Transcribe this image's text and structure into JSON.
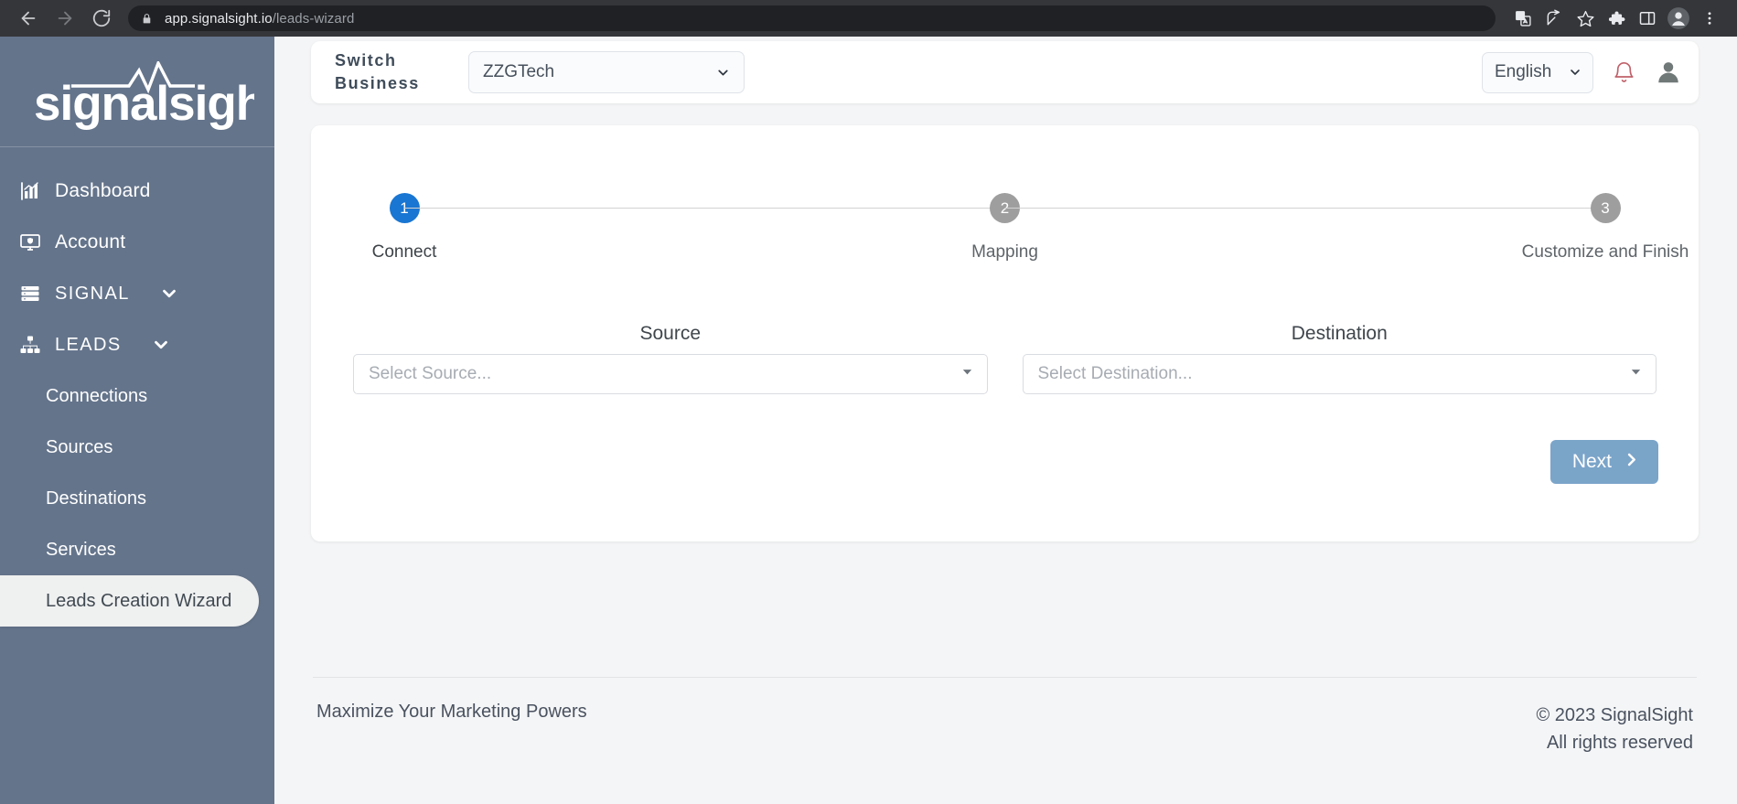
{
  "browser": {
    "back_icon": "arrow-left-icon",
    "forward_icon": "arrow-right-icon",
    "reload_icon": "reload-icon",
    "lock_icon": "lock-icon",
    "url_domain": "app.signalsight.io",
    "url_path": "/leads-wizard",
    "toolbar_icons": [
      "translate-icon",
      "share-icon",
      "bookmark-star-icon",
      "extensions-puzzle-icon",
      "side-panel-icon",
      "profile-avatar-icon",
      "three-dot-menu-icon"
    ]
  },
  "sidebar": {
    "logo_text": "signalsight",
    "items": [
      {
        "label": "Dashboard",
        "icon": "bar-chart-icon",
        "type": "link"
      },
      {
        "label": "Account",
        "icon": "monitor-shield-icon",
        "type": "link"
      },
      {
        "label": "SIGNAL",
        "icon": "server-stack-icon",
        "type": "group",
        "chevron": "chevron-down-icon"
      },
      {
        "label": "LEADS",
        "icon": "sitemap-icon",
        "type": "group",
        "chevron": "chevron-down-icon"
      }
    ],
    "sub_items": [
      {
        "label": "Connections",
        "active": false
      },
      {
        "label": "Sources",
        "active": false
      },
      {
        "label": "Destinations",
        "active": false
      },
      {
        "label": "Services",
        "active": false
      },
      {
        "label": "Leads Creation Wizard",
        "active": true
      }
    ]
  },
  "topbar": {
    "switch_business_label": "Switch Business",
    "switch_business_line1": "Switch",
    "switch_business_line2": "Business",
    "business_value": "ZZGTech",
    "business_options": [
      "ZZGTech"
    ],
    "language_value": "English",
    "language_options": [
      "English"
    ],
    "bell_icon": "notification-bell-icon",
    "avatar_icon": "user-avatar-icon"
  },
  "wizard": {
    "steps": [
      {
        "number": "1",
        "label": "Connect",
        "active": true
      },
      {
        "number": "2",
        "label": "Mapping",
        "active": false
      },
      {
        "number": "3",
        "label": "Customize and Finish",
        "active": false
      }
    ],
    "source": {
      "label": "Source",
      "placeholder": "Select Source...",
      "value": ""
    },
    "destination": {
      "label": "Destination",
      "placeholder": "Select Destination...",
      "value": ""
    },
    "next_label": "Next",
    "next_icon": "chevron-right-icon"
  },
  "footer": {
    "tagline": "Maximize Your Marketing Powers",
    "copyright": "© 2023 SignalSight",
    "rights": "All rights reserved"
  },
  "colors": {
    "sidebar_bg": "#64748b",
    "accent_active_step": "#1976d2",
    "inactive_step": "#9e9e9e",
    "next_button": "#7ba4c9",
    "page_bg": "#f4f5f6"
  }
}
